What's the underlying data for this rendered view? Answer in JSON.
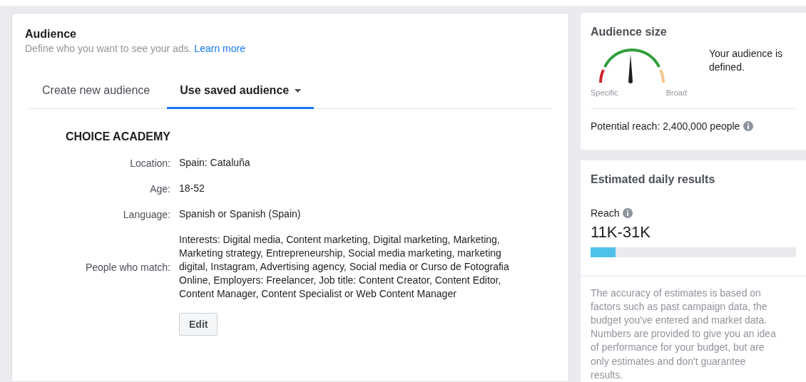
{
  "audience": {
    "title": "Audience",
    "subtitle": "Define who you want to see your ads.",
    "link": "Learn more",
    "tabs": [
      {
        "label": "Create new audience",
        "selected": false,
        "caret": false
      },
      {
        "label": "Use saved audience",
        "selected": true,
        "caret": true
      }
    ],
    "saved": {
      "name": "CHOICE ACADEMY",
      "rows": [
        {
          "label": "Location:",
          "value": "Spain: Cataluña"
        },
        {
          "label": "Age:",
          "value": "18-52"
        },
        {
          "label": "Language:",
          "value": "Spanish or Spanish (Spain)"
        },
        {
          "label": "People who match:",
          "value": "Interests: Digital media, Content marketing, Digital marketing, Marketing, Marketing strategy, Entrepreneurship, Social media marketing, marketing digital, Instagram, Advertising agency, Social media or Curso de Fotografia Online, Employers: Freelancer, Job title: Content Creator, Content Editor, Content Manager, Content Specialist or Web Content Manager"
        }
      ],
      "edit_button": "Edit"
    }
  },
  "audience_size": {
    "title": "Audience size",
    "gauge_min": "Specific",
    "gauge_max": "Broad",
    "status": "Your audience is defined.",
    "potential_reach": "Potential reach: 2,400,000 people"
  },
  "daily_results": {
    "title": "Estimated daily results",
    "metric": "Reach",
    "range": "11K-31K",
    "level": 0.12,
    "note": "The accuracy of estimates is based on factors such as past campaign data, the budget you've entered and market data. Numbers are provided to give you an idea of performance for your budget, but are only estimates and don't guarantee results."
  }
}
